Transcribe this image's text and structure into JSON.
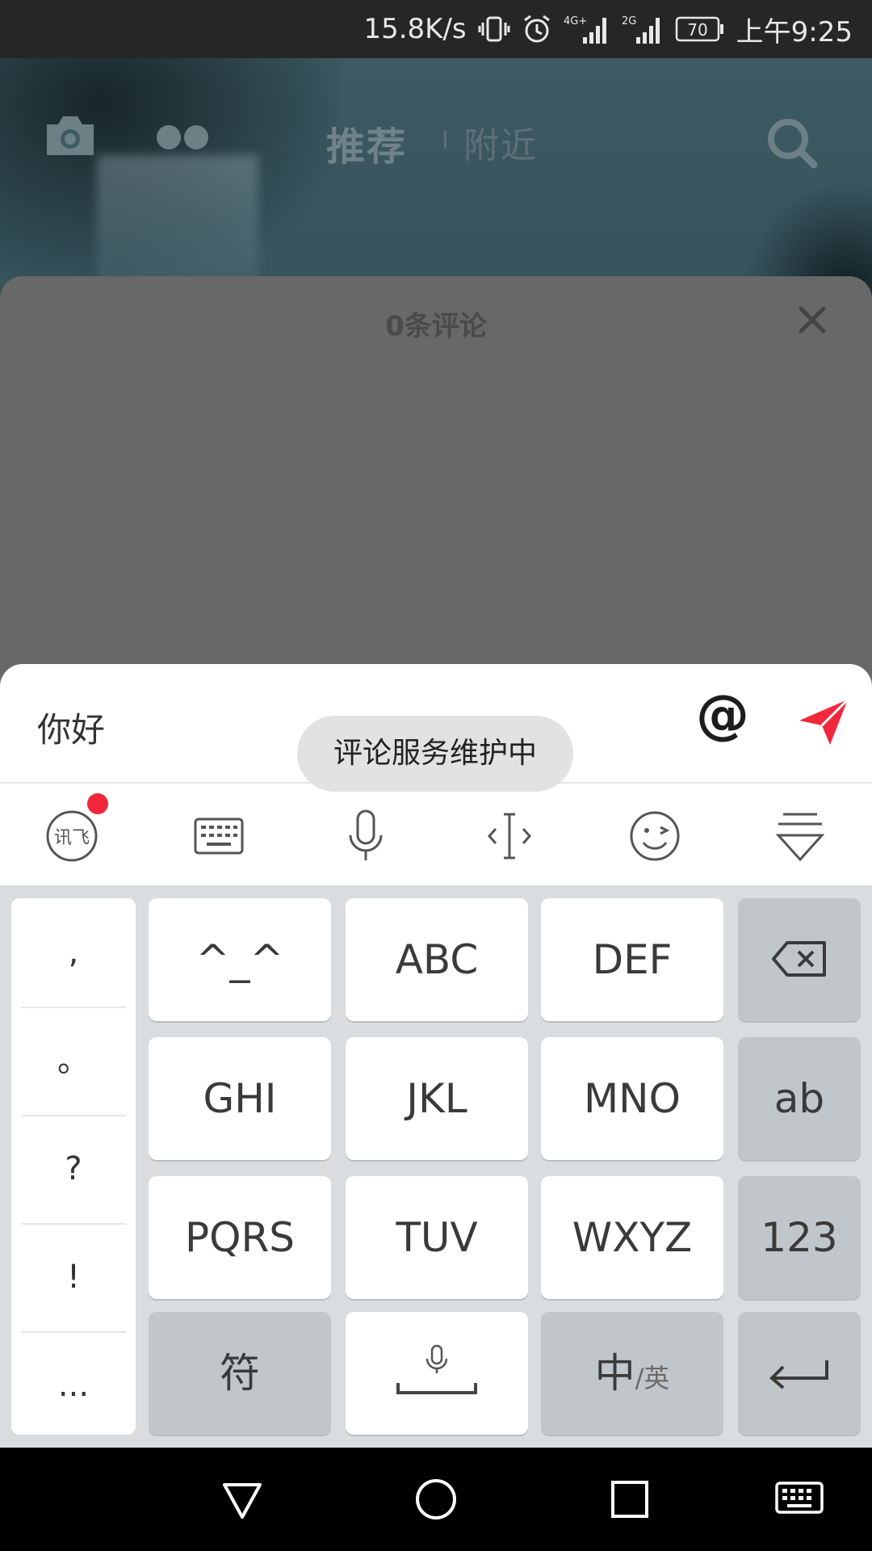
{
  "status_bar": {
    "net_speed": "15.8K/s",
    "network_1": "4G+",
    "network_2": "2G",
    "battery": "70",
    "time": "上午9:25"
  },
  "top_nav": {
    "tab_recommend": "推荐",
    "tab_nearby": "附近"
  },
  "comments": {
    "count_label": "0条评论"
  },
  "input": {
    "text": "你好",
    "at_label": "@"
  },
  "toast": {
    "message": "评论服务维护中"
  },
  "ime_toolbar": {
    "logo_text": "讯飞",
    "icons": [
      "ime-logo-icon",
      "keyboard-icon",
      "microphone-icon",
      "cursor-icon",
      "emoji-icon",
      "collapse-keyboard-icon"
    ]
  },
  "keyboard": {
    "punctuation": [
      ",",
      "。",
      "?",
      "!",
      "..."
    ],
    "keys": {
      "row1": [
        "^_^",
        "ABC",
        "DEF"
      ],
      "row2": [
        "GHI",
        "JKL",
        "MNO",
        "ab"
      ],
      "row3": [
        "PQRS",
        "TUV",
        "WXYZ",
        "123"
      ],
      "symbol": "符",
      "lang_main": "中",
      "lang_sub": "/英"
    }
  },
  "colors": {
    "send_red": "#f3273b",
    "badge_red": "#f3273b",
    "key_white": "#ffffff",
    "key_fn": "#c1c6ca",
    "keyboard_bg": "#d9dde0"
  }
}
